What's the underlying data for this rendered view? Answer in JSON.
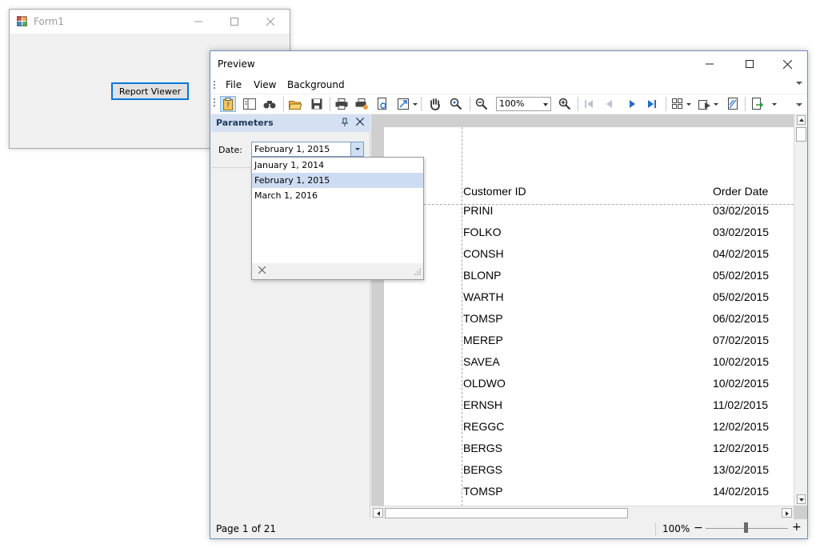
{
  "form1": {
    "title": "Form1",
    "button_label": "Report Viewer"
  },
  "preview": {
    "title": "Preview",
    "menu": [
      "File",
      "View",
      "Background"
    ],
    "toolbar": {
      "zoom_value": "100%",
      "icons": [
        "parameters-icon",
        "document-map-icon",
        "find-icon",
        "open-icon",
        "save-icon",
        "print-icon",
        "quick-print-icon",
        "page-setup-icon",
        "scale-icon",
        "hand-tool-icon",
        "magnifier-icon",
        "zoom-out-icon",
        "zoom-in-icon",
        "first-page-icon",
        "previous-page-icon",
        "next-page-icon",
        "last-page-icon",
        "multiple-pages-icon",
        "background-icon",
        "watermark-icon",
        "export-icon"
      ]
    },
    "parameters": {
      "header": "Parameters",
      "date_label": "Date:",
      "date_value": "February 1, 2015",
      "options": [
        "January 1, 2014",
        "February 1, 2015",
        "March 1, 2016"
      ],
      "selected_index": 1
    },
    "report": {
      "columns": [
        "Customer ID",
        "Order Date"
      ],
      "rows": [
        {
          "customer_id": "PRINI",
          "order_date": "03/02/2015"
        },
        {
          "customer_id": "FOLKO",
          "order_date": "03/02/2015"
        },
        {
          "customer_id": "CONSH",
          "order_date": "04/02/2015"
        },
        {
          "customer_id": "BLONP",
          "order_date": "05/02/2015"
        },
        {
          "customer_id": "WARTH",
          "order_date": "05/02/2015"
        },
        {
          "customer_id": "TOMSP",
          "order_date": "06/02/2015"
        },
        {
          "customer_id": "MEREP",
          "order_date": "07/02/2015"
        },
        {
          "customer_id": "SAVEA",
          "order_date": "10/02/2015"
        },
        {
          "customer_id": "OLDWO",
          "order_date": "10/02/2015"
        },
        {
          "customer_id": "ERNSH",
          "order_date": "11/02/2015"
        },
        {
          "customer_id": "REGGC",
          "order_date": "12/02/2015"
        },
        {
          "customer_id": "BERGS",
          "order_date": "12/02/2015"
        },
        {
          "customer_id": "BERGS",
          "order_date": "13/02/2015"
        },
        {
          "customer_id": "TOMSP",
          "order_date": "14/02/2015"
        }
      ]
    },
    "status": {
      "page": "Page 1 of 21",
      "zoom": "100%",
      "zoom_minus": "−",
      "zoom_plus": "+"
    }
  },
  "colors": {
    "accent": "#0078d7",
    "panel_header": "#d5e1f2",
    "selection": "#cddcf3",
    "nav_blue": "#1e6ec8"
  }
}
